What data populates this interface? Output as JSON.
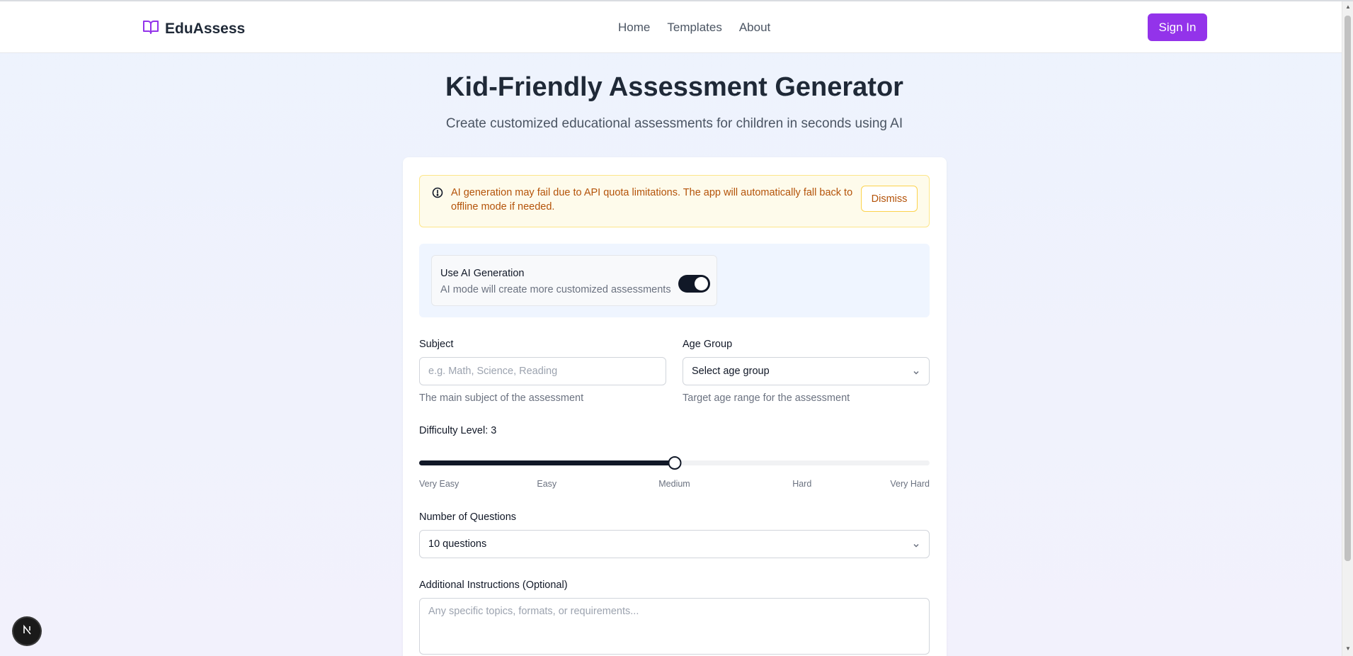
{
  "header": {
    "logo_text": "EduAssess",
    "nav": [
      "Home",
      "Templates",
      "About"
    ],
    "signin_label": "Sign In"
  },
  "hero": {
    "title": "Kid-Friendly Assessment Generator",
    "subtitle": "Create customized educational assessments for children in seconds using AI"
  },
  "alert": {
    "message": "AI generation may fail due to API quota limitations. The app will automatically fall back to offline mode if needed.",
    "dismiss_label": "Dismiss"
  },
  "ai_toggle": {
    "title": "Use AI Generation",
    "description": "AI mode will create more customized assessments",
    "enabled": true
  },
  "form": {
    "subject": {
      "label": "Subject",
      "placeholder": "e.g. Math, Science, Reading",
      "value": "",
      "help": "The main subject of the assessment"
    },
    "age_group": {
      "label": "Age Group",
      "value": "Select age group",
      "help": "Target age range for the assessment"
    },
    "difficulty": {
      "label": "Difficulty Level: 3",
      "value": 3,
      "min": 1,
      "max": 5,
      "ticks": [
        "Very Easy",
        "Easy",
        "Medium",
        "Hard",
        "Very Hard"
      ]
    },
    "num_questions": {
      "label": "Number of Questions",
      "value": "10 questions"
    },
    "instructions": {
      "label": "Additional Instructions (Optional)",
      "placeholder": "Any specific topics, formats, or requirements..."
    }
  },
  "colors": {
    "brand": "#9333ea",
    "alert_text": "#b45309",
    "alert_bg": "#fefbeb",
    "dark": "#111827"
  }
}
